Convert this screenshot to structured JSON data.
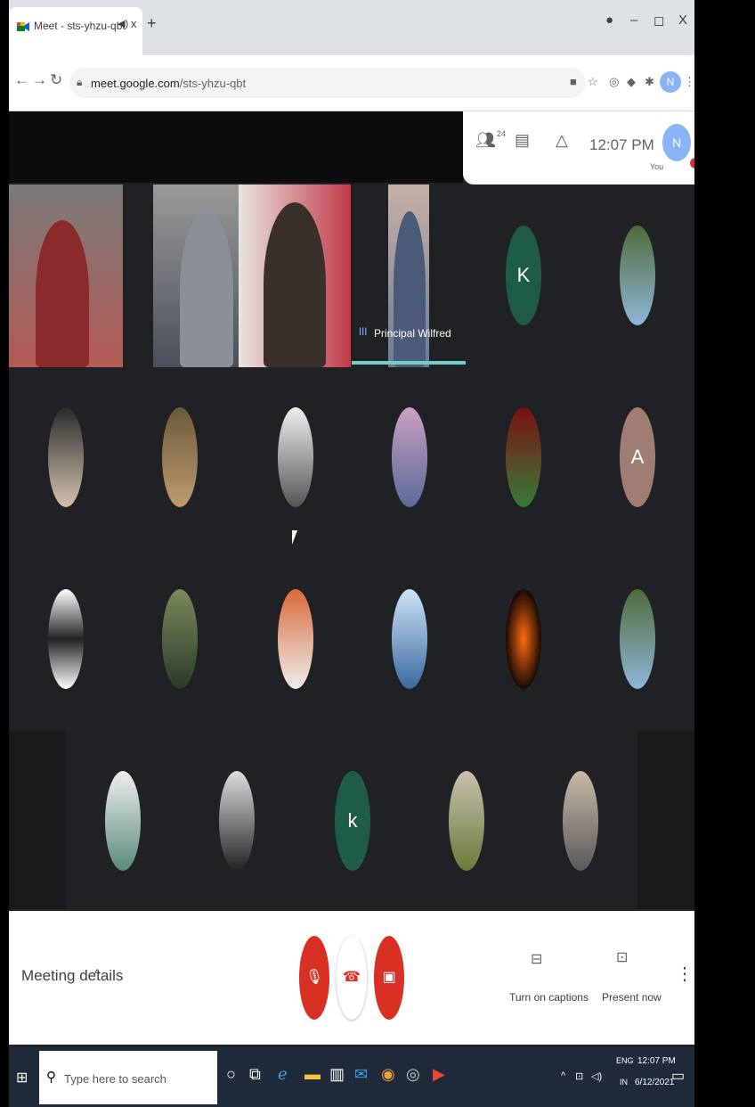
{
  "browser": {
    "tab_title": "Meet - sts-yhzu-qbt",
    "tab_audio_icon": "speaker-icon",
    "tab_close": "x",
    "new_tab": "+",
    "win_controls": [
      "–",
      "◻",
      "X"
    ],
    "url_host": "meet.google.com",
    "url_path": "/sts-yhzu-qbt",
    "profile_initial": "N"
  },
  "meet": {
    "participants_badge": "24",
    "clock": "12:07 PM",
    "self_initial": "N",
    "self_label": "You",
    "active_speaker": "Principal Wilfred",
    "letter_tiles": [
      "K",
      "A",
      "k"
    ]
  },
  "controls": {
    "meeting_details": "Meeting details",
    "chevron": "^",
    "captions_label": "Turn on captions",
    "present_label": "Present now"
  },
  "taskbar": {
    "search_placeholder": "Type here to search",
    "lang_top": "ENG",
    "lang_bottom": "IN",
    "time": "12:07 PM",
    "date": "6/12/2021"
  },
  "colors": {
    "meet_bg": "#202124",
    "danger_red": "#d93025",
    "speaker_teal": "#6fcfc0",
    "avatar_green": "#1e5c45",
    "avatar_brown": "#a07d72"
  }
}
